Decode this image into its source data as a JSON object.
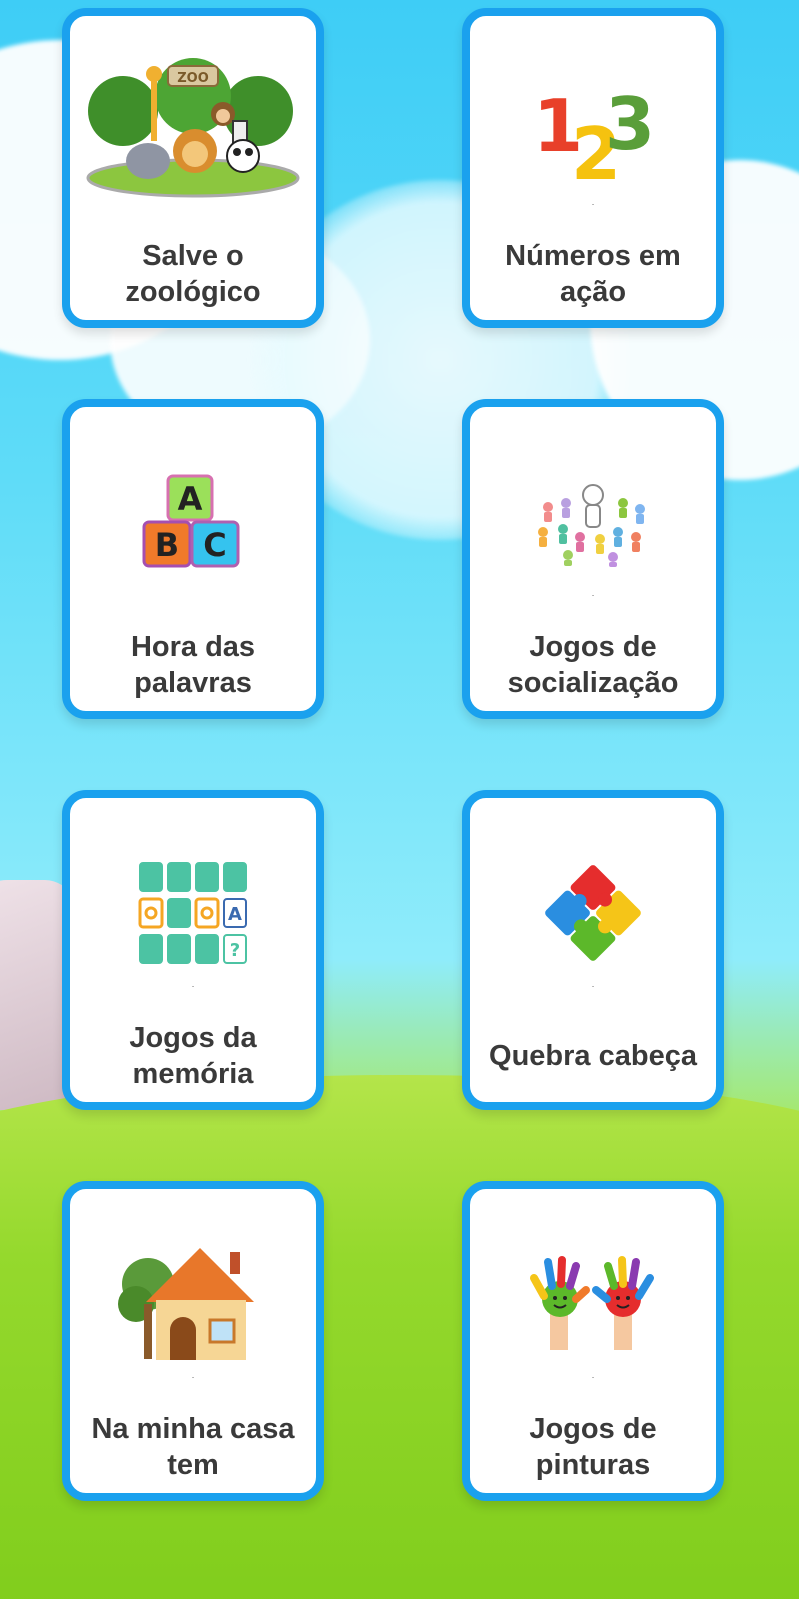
{
  "cards": [
    {
      "line1": "Salve o",
      "line2": "zoológico",
      "icon": "zoo-icon",
      "dot": ""
    },
    {
      "line1": "Números em",
      "line2": "ação",
      "icon": "numbers-123-icon",
      "dot": "."
    },
    {
      "line1": "Hora das",
      "line2": "palavras",
      "icon": "abc-blocks-icon",
      "dot": ""
    },
    {
      "line1": "Jogos de",
      "line2": "socialização",
      "icon": "people-group-icon",
      "dot": "."
    },
    {
      "line1": "Jogos da",
      "line2": "memória",
      "icon": "memory-cards-icon",
      "dot": "."
    },
    {
      "line1": "Quebra cabeça",
      "line2": "",
      "icon": "puzzle-icon",
      "dot": "."
    },
    {
      "line1": "Na minha casa",
      "line2": "tem",
      "icon": "house-icon",
      "dot": "."
    },
    {
      "line1": "Jogos de",
      "line2": "pinturas",
      "icon": "painted-hands-icon",
      "dot": "."
    }
  ],
  "colors": {
    "card_border": "#1aa1ee",
    "text": "#3a3a3a",
    "sky": "#3ecdf6",
    "grass": "#7ccd1c"
  }
}
